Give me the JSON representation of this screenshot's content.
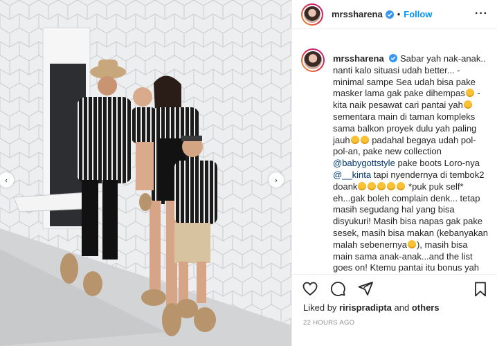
{
  "post": {
    "username": "mrssharena",
    "verified": true,
    "separator": "•",
    "follow_label": "Follow",
    "more_label": "···"
  },
  "photo": {
    "description_icon": "photo-image",
    "prev_glyph": "‹",
    "next_glyph": "›"
  },
  "caption": {
    "author": "mrssharena",
    "text_1": "Sabar yah nak-anak.. nanti kalo situasi udah better... - minimal sampe Sea udah bisa pake masker lama gak pake dihempas",
    "text_2": "- kita naik pesawat cari pantai yah",
    "text_3": "sementara main di taman kompleks sama balkon proyek dulu yah paling jauh",
    "text_4": "padahal begaya udah pol-pol-an, pake new collection",
    "mention_1": "@babygottstyle",
    "text_5": "pake boots Loro-nya",
    "mention_2": "@__kinta",
    "text_6": "tapi nyendernya di tembok2 doank",
    "text_7": "*puk puk self* eh...gak boleh complain denk... tetap masih segudang hal yang bisa disyukuri! Masih bisa napas gak pake sesek, masih bisa makan (kebanyakan malah sebenernya",
    "text_8": "), masih bisa main sama anak-anak...and the list goes on! Ktemu pantai itu bonus yah nak nanti...duh...pengen"
  },
  "likes": {
    "prefix": "Liked by",
    "user": "ririspradipta",
    "connector": "and",
    "others": "others"
  },
  "timestamp": "22 HOURS AGO",
  "icons": {
    "like": "heart-icon",
    "comment": "comment-icon",
    "share": "share-icon",
    "save": "bookmark-icon",
    "verified": "verified-badge-icon"
  },
  "colors": {
    "accent": "#0095f6",
    "mention": "#00376b",
    "text": "#262626",
    "muted": "#8e8e8e",
    "border": "#efefef"
  }
}
